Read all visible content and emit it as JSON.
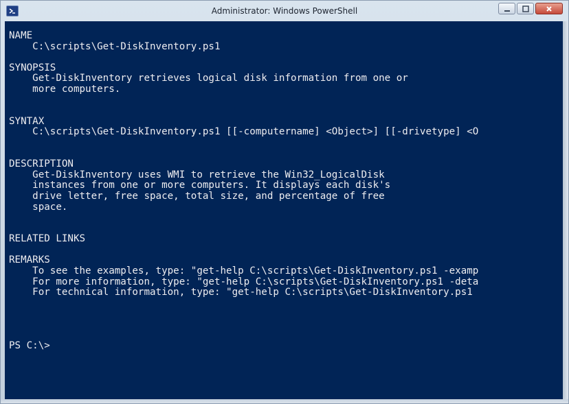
{
  "window": {
    "title": "Administrator: Windows PowerShell",
    "icon": "powershell-icon",
    "controls": [
      "minimize-icon",
      "maximize-icon",
      "close-icon"
    ]
  },
  "colors": {
    "console_background": "#012456",
    "console_text": "#eeedf0"
  },
  "console": {
    "lines": [
      "NAME",
      "    C:\\scripts\\Get-DiskInventory.ps1",
      "",
      "SYNOPSIS",
      "    Get-DiskInventory retrieves logical disk information from one or",
      "    more computers.",
      "",
      "",
      "SYNTAX",
      "    C:\\scripts\\Get-DiskInventory.ps1 [[-computername] <Object>] [[-drivetype] <O",
      "",
      "",
      "DESCRIPTION",
      "    Get-DiskInventory uses WMI to retrieve the Win32_LogicalDisk",
      "    instances from one or more computers. It displays each disk's",
      "    drive letter, free space, total size, and percentage of free",
      "    space.",
      "",
      "",
      "RELATED LINKS",
      "",
      "REMARKS",
      "    To see the examples, type: \"get-help C:\\scripts\\Get-DiskInventory.ps1 -examp",
      "    For more information, type: \"get-help C:\\scripts\\Get-DiskInventory.ps1 -deta",
      "    For technical information, type: \"get-help C:\\scripts\\Get-DiskInventory.ps1",
      "",
      "",
      "",
      "",
      "PS C:\\>"
    ]
  }
}
